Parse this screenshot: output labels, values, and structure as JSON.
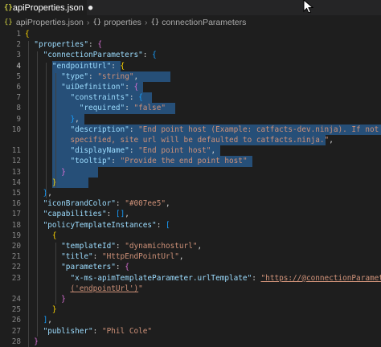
{
  "tab": {
    "file_icon": "{}",
    "title": "apiProperties.json",
    "dirty_indicator": "●"
  },
  "breadcrumb": {
    "file_icon": "{}",
    "file": "apiProperties.json",
    "sep": "›",
    "sym_icon": "{}",
    "item1": "properties",
    "item2": "connectionParameters"
  },
  "editor": {
    "lines": [
      {
        "n": "1",
        "t": "{"
      },
      {
        "n": "2",
        "t": "  \"properties\": {"
      },
      {
        "n": "3",
        "t": "    \"connectionParameters\": {"
      },
      {
        "n": "4",
        "t": "      \"endpointUrl\": {"
      },
      {
        "n": "5",
        "t": "        \"type\": \"string\","
      },
      {
        "n": "6",
        "t": "        \"uiDefinition\": {"
      },
      {
        "n": "7",
        "t": "          \"constraints\": {"
      },
      {
        "n": "8",
        "t": "            \"required\": \"false\""
      },
      {
        "n": "9",
        "t": "          },"
      },
      {
        "n": "10",
        "t": "          \"description\": \"End point host (Example: catfacts-dev.ninja). If not"
      },
      {
        "n": "",
        "t": "          specified, site url will be defaulted to catfacts.ninja.\","
      },
      {
        "n": "11",
        "t": "          \"displayName\": \"End point host\","
      },
      {
        "n": "12",
        "t": "          \"tooltip\": \"Provide the end point host\""
      },
      {
        "n": "13",
        "t": "        }"
      },
      {
        "n": "14",
        "t": "      }"
      },
      {
        "n": "15",
        "t": "    },"
      },
      {
        "n": "16",
        "t": "    \"iconBrandColor\": \"#007ee5\","
      },
      {
        "n": "17",
        "t": "    \"capabilities\": [],"
      },
      {
        "n": "18",
        "t": "    \"policyTemplateInstances\": ["
      },
      {
        "n": "19",
        "t": "      {"
      },
      {
        "n": "20",
        "t": "        \"templateId\": \"dynamichosturl\","
      },
      {
        "n": "21",
        "t": "        \"title\": \"HttpEndPointUrl\","
      },
      {
        "n": "22",
        "t": "        \"parameters\": {"
      },
      {
        "n": "23",
        "t": "          \"x-ms-apimTemplateParameter.urlTemplate\": \"https://@connectionParameters"
      },
      {
        "n": "",
        "t": "          ('endpointUrl')\""
      },
      {
        "n": "24",
        "t": "        }"
      },
      {
        "n": "25",
        "t": "      }"
      },
      {
        "n": "26",
        "t": "    ],"
      },
      {
        "n": "27",
        "t": "    \"publisher\": \"Phil Cole\""
      },
      {
        "n": "28",
        "t": "  }"
      },
      {
        "n": "29",
        "t": "}"
      }
    ]
  }
}
